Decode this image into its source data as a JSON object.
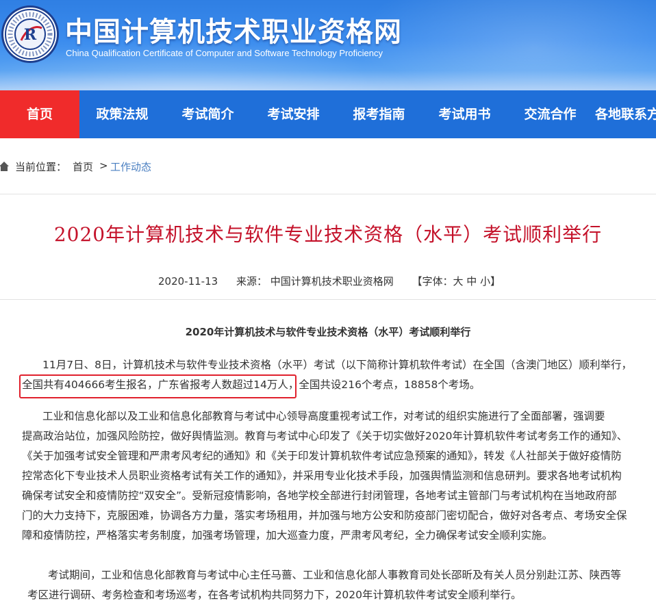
{
  "header": {
    "seal_ring_text": "中国计算机资格考试 · Computer Qualification Certificate",
    "seal_letter": "R",
    "title": "中国计算机技术职业资格网",
    "subtitle": "China Qualification Certificate of Computer and Software Technology Proficiency"
  },
  "nav": {
    "items": [
      {
        "label": "首页",
        "active": true
      },
      {
        "label": "政策法规"
      },
      {
        "label": "考试简介"
      },
      {
        "label": "考试安排"
      },
      {
        "label": "报考指南"
      },
      {
        "label": "考试用书"
      },
      {
        "label": "交流合作"
      },
      {
        "label": "各地联系方"
      }
    ]
  },
  "breadcrumb": {
    "prefix": "当前位置：",
    "home": "首页",
    "separator": ">",
    "current": "工作动态"
  },
  "article": {
    "title": "2020年计算机技术与软件专业技术资格（水平）考试顺利举行",
    "date": "2020-11-13",
    "source": "来源： 中国计算机技术职业资格网",
    "font_size_label": "【字体：大 中 小】",
    "inner_title": "2020年计算机技术与软件专业技术资格（水平）考试顺利举行",
    "p1_line1": "11月7日、8日，计算机技术与软件专业技术资格（水平）考试（以下简称计算机软件考试）在全国（含澳门地区）顺利举行，",
    "p1_highlight": "全国共有404666考生报名，广东省报考人数超过14万人",
    "p1_rest": "，全国共设216个考点，18858个考场。",
    "p2_lines": [
      "工业和信息化部以及工业和信息化部教育与考试中心领导高度重视考试工作，对考试的组织实施进行了全面部署，强调要",
      "提高政治站位，加强风险防控，做好舆情监测。教育与考试中心印发了《关于切实做好2020年计算机软件考试考务工作的通知》、",
      "《关于加强考试安全管理和严肃考风考纪的通知》和《关于印发计算机软件考试应急预案的通知》，转发《人社部关于做好疫情防",
      "控常态化下专业技术人员职业资格考试有关工作的通知》，并采用专业化技术手段，加强舆情监测和信息研判。要求各地考试机构",
      "确保考试安全和疫情防控“双安全”。受新冠疫情影响，各地学校全部进行封闭管理，各地考试主管部门与考试机构在当地政府部",
      "门的大力支持下，克服困难，协调各方力量，落实考场租用，并加强与地方公安和防疫部门密切配合，做好对各考点、考场安全保",
      "障和疫情防控，严格落实考务制度，加强考场管理，加大巡查力度，严肃考风考纪，全力确保考试安全顺利实施。"
    ],
    "p3_lines": [
      "考试期间，工业和信息化部教育与考试中心主任马蔷、工业和信息化部人事教育司处长邵昕及有关人员分别赴江苏、陕西等",
      "考区进行调研、考务检查和考场巡考，在各考试机构共同努力下，2020年计算机软件考试安全顺利举行。"
    ]
  },
  "colors": {
    "nav_bg": "#1f6fd9",
    "nav_active": "#f02b2b",
    "title_red": "#c4122a",
    "highlight_border": "#e0202c",
    "link_blue": "#4a7fc1"
  }
}
